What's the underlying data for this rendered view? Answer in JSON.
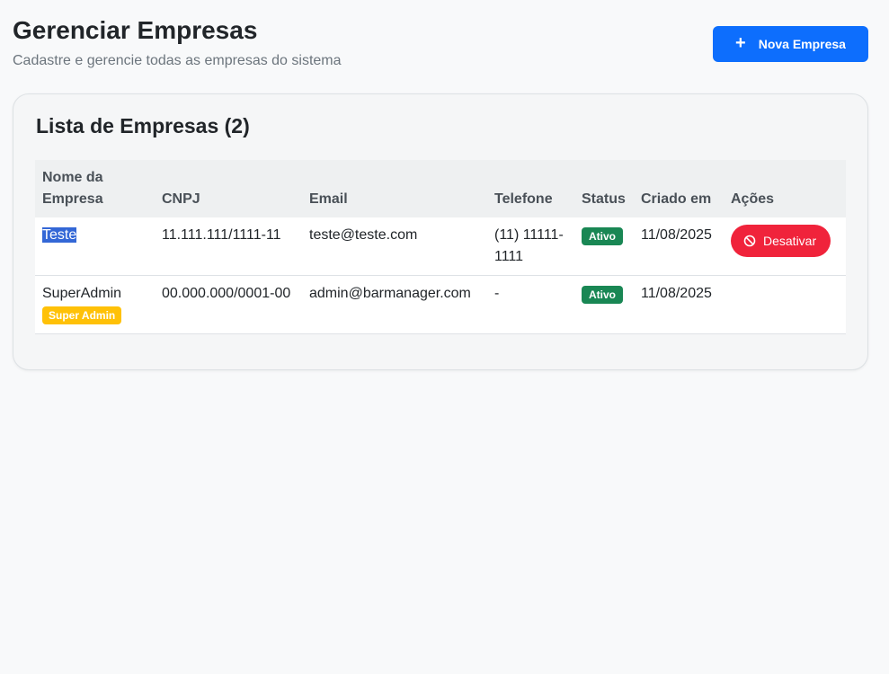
{
  "header": {
    "title": "Gerenciar Empresas",
    "subtitle": "Cadastre e gerencie todas as empresas do sistema",
    "new_button_label": "Nova Empresa"
  },
  "card": {
    "title": "Lista de Empresas (2)"
  },
  "table": {
    "columns": {
      "name": "Nome da Empresa",
      "cnpj": "CNPJ",
      "email": "Email",
      "phone": "Telefone",
      "status": "Status",
      "created": "Criado em",
      "actions": "Ações"
    },
    "rows": [
      {
        "name": "Teste",
        "cnpj": "11.111.111/1111-11",
        "email": "teste@teste.com",
        "phone": "(11) 11111-1111",
        "status": "Ativo",
        "created": "11/08/2025",
        "action_label": "Desativar"
      },
      {
        "name": "SuperAdmin",
        "role_badge": "Super Admin",
        "cnpj": "00.000.000/0001-00",
        "email": "admin@barmanager.com",
        "phone": "-",
        "status": "Ativo",
        "created": "11/08/2025"
      }
    ]
  },
  "icons": {
    "new_button": "plus-icon",
    "deactivate_button": "ban-icon"
  },
  "colors": {
    "primary": "#0d6efd",
    "success": "#198754",
    "danger": "#f0233b",
    "warning": "#ffc107"
  }
}
